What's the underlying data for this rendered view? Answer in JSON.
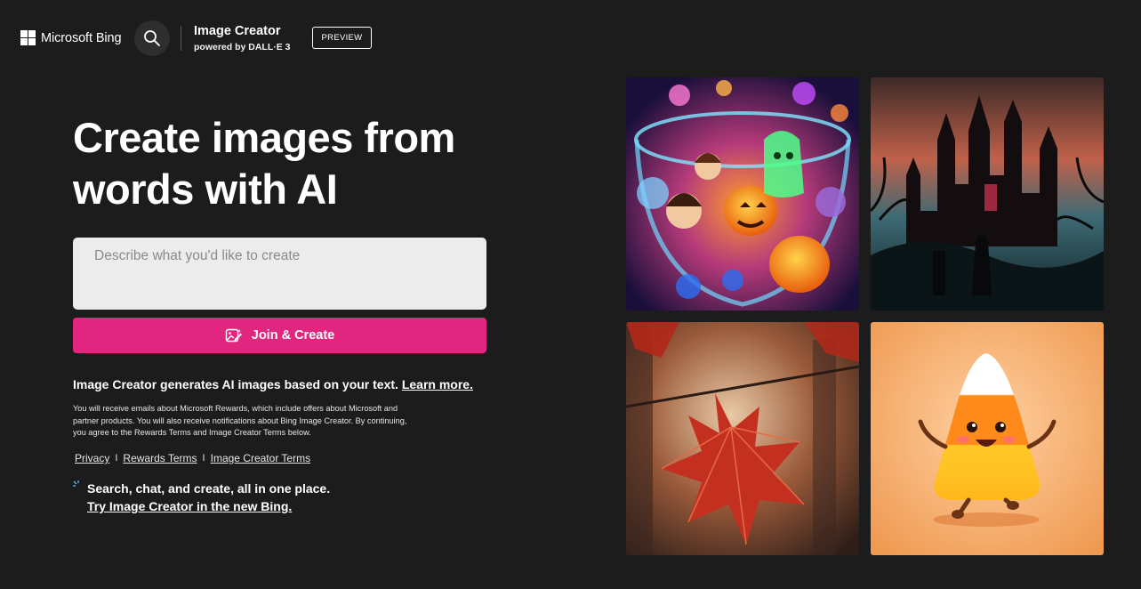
{
  "header": {
    "logo_text": "Microsoft Bing",
    "brand_title": "Image Creator",
    "brand_subtitle": "powered by DALL·E 3",
    "preview_label": "PREVIEW"
  },
  "hero": {
    "title": "Create images from words with AI"
  },
  "prompt": {
    "placeholder": "Describe what you'd like to create",
    "value": ""
  },
  "create_button": {
    "label": "Join & Create"
  },
  "info": {
    "text": "Image Creator generates AI images based on your text.",
    "learn_more": "Learn more."
  },
  "disclaimer": "You will receive emails about Microsoft Rewards, which include offers about Microsoft and partner products. You will also receive notifications about Bing Image Creator. By continuing, you agree to the Rewards Terms and Image Creator Terms below.",
  "links": [
    {
      "label": "Privacy"
    },
    {
      "label": "Rewards Terms"
    },
    {
      "label": "Image Creator Terms"
    }
  ],
  "link_separator": "I",
  "promo": {
    "title": "Search, chat, and create, all in one place.",
    "link": "Try Image Creator in the new Bing."
  },
  "gallery": [
    {
      "icon": "halloween-fishbowl-image"
    },
    {
      "icon": "gothic-castle-image"
    },
    {
      "icon": "autumn-maple-leaf-image"
    },
    {
      "icon": "candy-corn-character-image"
    }
  ],
  "colors": {
    "background": "#1c1c1c",
    "accent": "#e0267f",
    "input_bg": "#ececec"
  }
}
